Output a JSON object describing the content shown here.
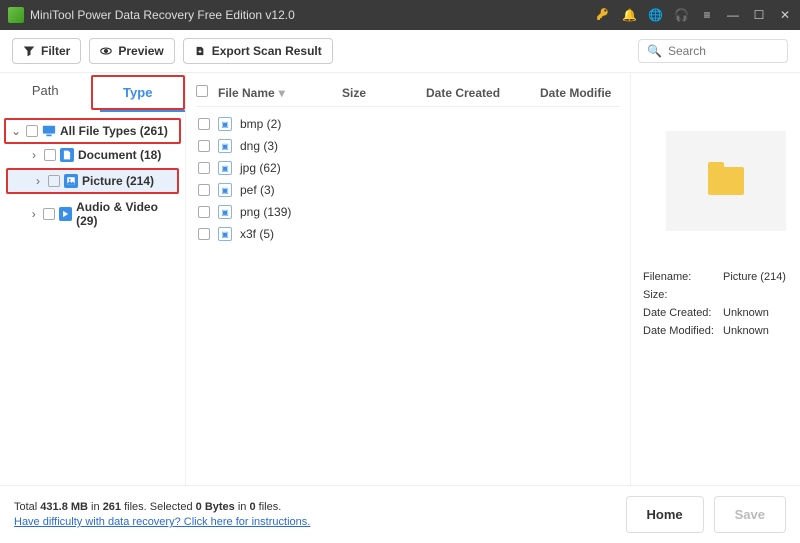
{
  "titlebar": {
    "title": "MiniTool Power Data Recovery Free Edition v12.0"
  },
  "toolbar": {
    "filter": "Filter",
    "preview": "Preview",
    "export": "Export Scan Result",
    "search_placeholder": "Search"
  },
  "tabs": {
    "path": "Path",
    "type": "Type"
  },
  "tree": {
    "root": "All File Types (261)",
    "items": [
      {
        "label": "Document (18)",
        "icon": "doc"
      },
      {
        "label": "Picture (214)",
        "icon": "pic",
        "selected": true
      },
      {
        "label": "Audio & Video (29)",
        "icon": "av"
      }
    ]
  },
  "columns": {
    "name": "File Name",
    "size": "Size",
    "created": "Date Created",
    "modified": "Date Modifie"
  },
  "files": [
    {
      "name": "bmp (2)"
    },
    {
      "name": "dng (3)"
    },
    {
      "name": "jpg (62)"
    },
    {
      "name": "pef (3)"
    },
    {
      "name": "png (139)"
    },
    {
      "name": "x3f (5)"
    }
  ],
  "details": {
    "filename_label": "Filename:",
    "filename": "Picture (214)",
    "size_label": "Size:",
    "size": "",
    "created_label": "Date Created:",
    "created": "Unknown",
    "modified_label": "Date Modified:",
    "modified": "Unknown"
  },
  "footer": {
    "total_prefix": "Total ",
    "total_size": "431.8 MB",
    "in1": " in ",
    "total_files": "261",
    "files_suffix": " files.   Selected ",
    "sel_bytes": "0 Bytes",
    "in2": " in ",
    "sel_files": "0",
    "sel_suffix": " files.",
    "help": "Have difficulty with data recovery? Click here for instructions.",
    "home": "Home",
    "save": "Save"
  }
}
